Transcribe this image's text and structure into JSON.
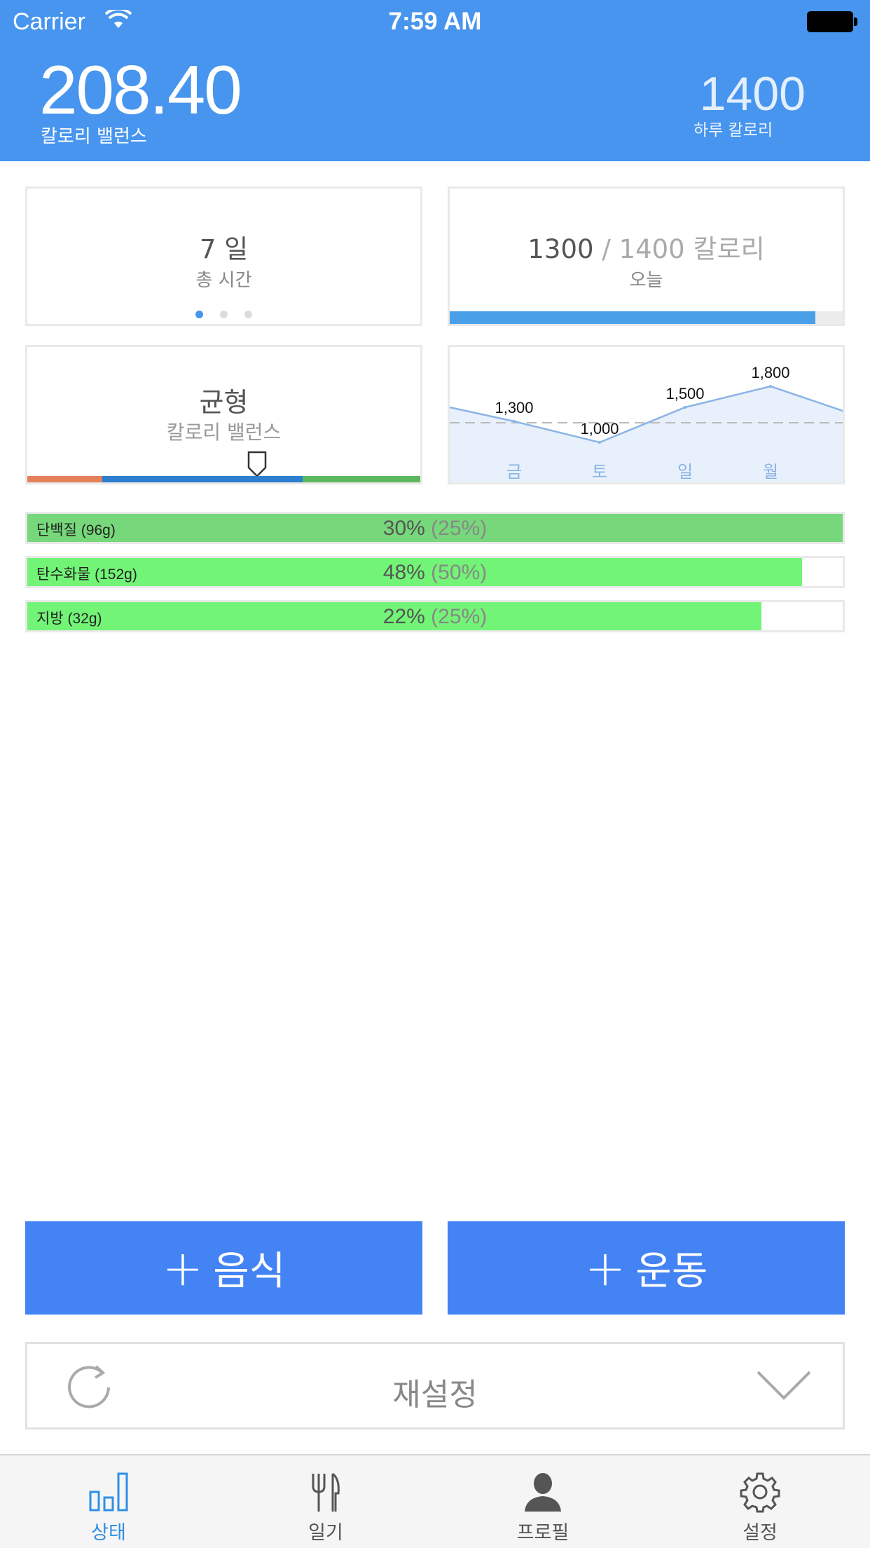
{
  "status_bar": {
    "carrier": "Carrier",
    "time": "7:59 AM"
  },
  "header": {
    "balance_value": "208.40",
    "balance_label": "칼로리 밸런스",
    "daily_value": "1400",
    "daily_label": "하루 칼로리"
  },
  "cards": {
    "days": {
      "value": "7 일",
      "label": "총 시간",
      "page_count": 3,
      "active_page": 0
    },
    "today": {
      "consumed": "1300",
      "separator": " / ",
      "goal": "1400 칼로리",
      "label": "오늘",
      "progress": 0.93
    },
    "balance": {
      "value": "균형",
      "label": "칼로리 밸런스",
      "segments": [
        {
          "color": "#e5805c",
          "fraction": 0.19
        },
        {
          "color": "#2d7ecf",
          "fraction": 0.51
        },
        {
          "color": "#5cb85c",
          "fraction": 0.3
        }
      ],
      "marker": 0.585
    }
  },
  "chart_data": {
    "type": "line",
    "categories": [
      "금",
      "토",
      "일",
      "월"
    ],
    "values": [
      1300,
      1000,
      1500,
      1800
    ],
    "data_labels": [
      "1,300",
      "1,000",
      "1,500",
      "1,800"
    ],
    "reference": 1400,
    "title": "",
    "xlabel": "",
    "ylabel": "",
    "line_color": "#8ab4e6",
    "fill_color": "#e8f0fb"
  },
  "macros": [
    {
      "name": "단백질 (96g)",
      "pct": "30%",
      "target": "(25%)",
      "fill": 1.0,
      "color": "#76d87a"
    },
    {
      "name": "탄수화물 (152g)",
      "pct": "48%",
      "target": "(50%)",
      "fill": 0.95,
      "color": "#72f476"
    },
    {
      "name": "지방 (32g)",
      "pct": "22%",
      "target": "(25%)",
      "fill": 0.9,
      "color": "#72f476"
    }
  ],
  "actions": {
    "food_plus": "+",
    "food_label": "음식",
    "exercise_plus": "+",
    "exercise_label": "운동",
    "reset_label": "재설정"
  },
  "tabs": [
    {
      "label": "상태",
      "icon": "bar-chart-icon",
      "active": true
    },
    {
      "label": "일기",
      "icon": "fork-knife-icon",
      "active": false
    },
    {
      "label": "프로필",
      "icon": "person-icon",
      "active": false
    },
    {
      "label": "설정",
      "icon": "gear-icon",
      "active": false
    }
  ],
  "colors": {
    "header": "#4795ee",
    "accent": "#4383f3",
    "active_tab": "#2e8fe5"
  }
}
